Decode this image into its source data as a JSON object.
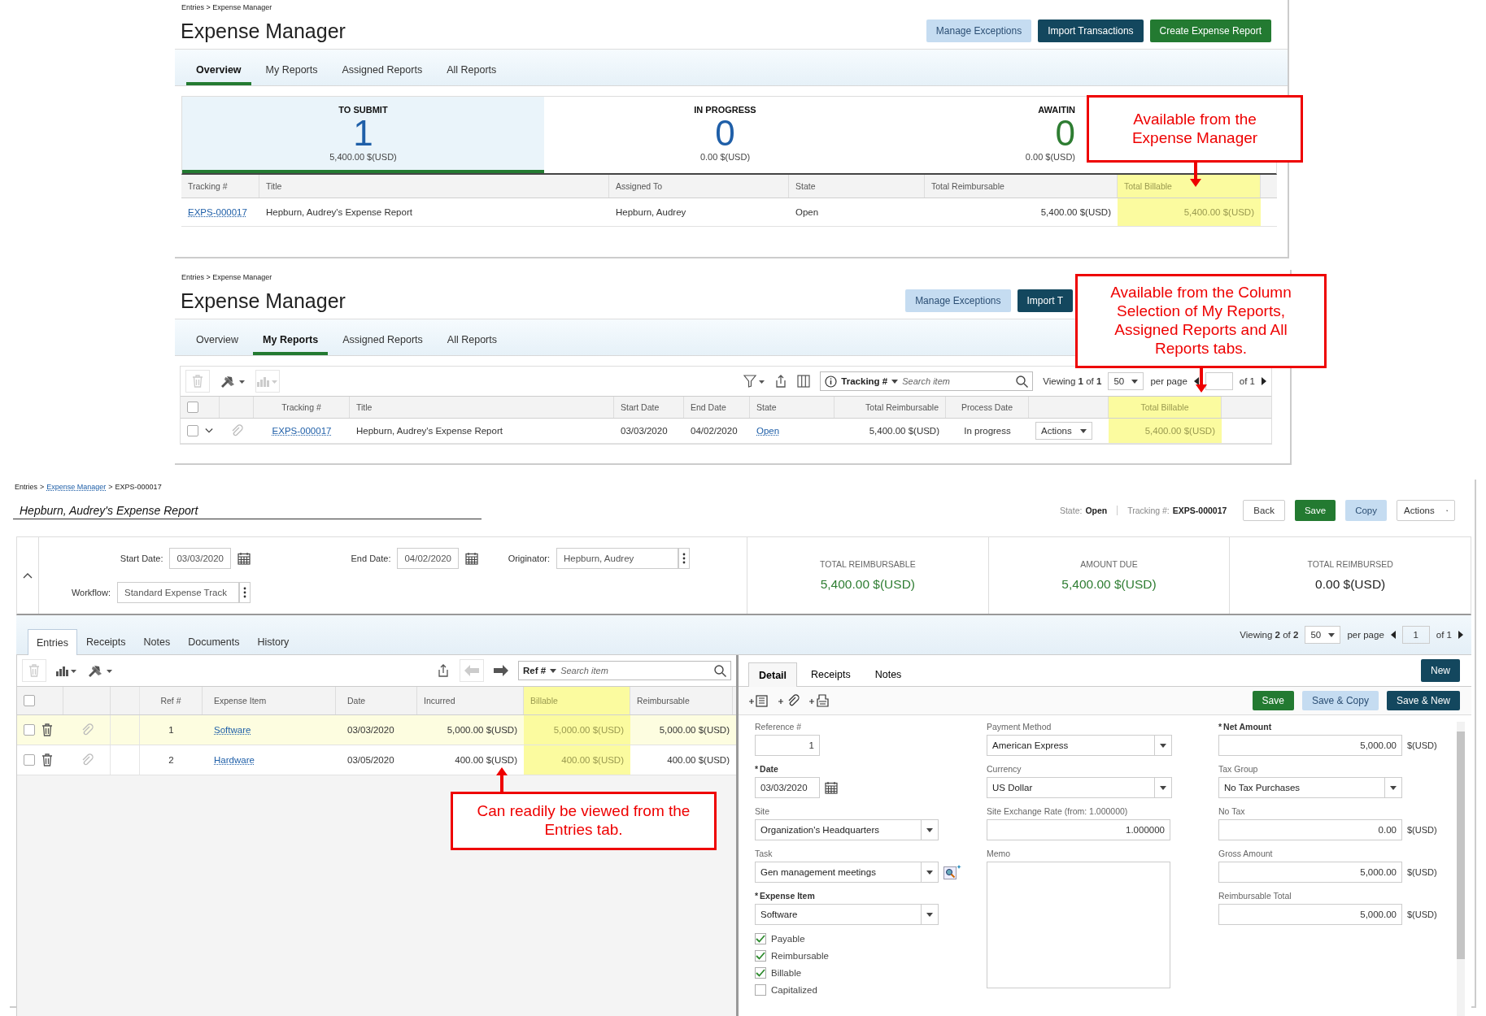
{
  "overview_panel": {
    "breadcrumb": "Entries > Expense Manager",
    "title": "Expense Manager",
    "buttons": [
      {
        "label": "Manage Exceptions",
        "kind": "light"
      },
      {
        "label": "Import Transactions",
        "kind": "dark"
      },
      {
        "label": "Create Expense Report",
        "kind": "green"
      }
    ],
    "tabs": [
      {
        "label": "Overview",
        "selected": true
      },
      {
        "label": "My Reports",
        "selected": false
      },
      {
        "label": "Assigned Reports",
        "selected": false
      },
      {
        "label": "All Reports",
        "selected": false
      }
    ],
    "stats": [
      {
        "label": "TO SUBMIT",
        "value": "1",
        "amount": "5,400.00 $(USD)",
        "selected": true,
        "color": "#1f5fa8"
      },
      {
        "label": "IN PROGRESS",
        "value": "0",
        "amount": "0.00 $(USD)",
        "selected": false,
        "color": "#1f5fa8"
      },
      {
        "label": "AWAITIN",
        "value": "0",
        "amount": "0.00 $(USD)",
        "selected": false,
        "color": "#2e7d32"
      }
    ],
    "table": {
      "columns": [
        {
          "label": "Tracking #",
          "highlighted": false,
          "kind": "link"
        },
        {
          "label": "Title",
          "highlighted": false,
          "kind": "text"
        },
        {
          "label": "Assigned To",
          "highlighted": false,
          "kind": "text"
        },
        {
          "label": "State",
          "highlighted": false,
          "kind": "text"
        },
        {
          "label": "Total Reimbursable",
          "highlighted": false,
          "kind": "number"
        },
        {
          "label": "Total Billable",
          "highlighted": true,
          "kind": "number"
        }
      ],
      "rows": [
        [
          "EXPS-000017",
          "Hepburn, Audrey's Expense Report",
          "Hepburn, Audrey",
          "Open",
          "5,400.00 $(USD)",
          "5,400.00 $(USD)"
        ]
      ]
    },
    "callout": "Available from the Expense Manager"
  },
  "my_reports_panel": {
    "breadcrumb": "Entries > Expense Manager",
    "title": "Expense Manager",
    "buttons": [
      {
        "label": "Manage Exceptions",
        "kind": "light"
      },
      {
        "label": "Import T",
        "kind": "dark"
      }
    ],
    "tabs": [
      {
        "label": "Overview",
        "selected": false
      },
      {
        "label": "My Reports",
        "selected": true
      },
      {
        "label": "Assigned Reports",
        "selected": false
      },
      {
        "label": "All Reports",
        "selected": false
      }
    ],
    "search": {
      "field": "Tracking #",
      "placeholder": "Search item"
    },
    "pager": {
      "viewing": "Viewing **1** of **1**",
      "per_page_value": "50",
      "per_page": "per page",
      "of": "of 1"
    },
    "table": {
      "all_checked": false,
      "columns": [
        {
          "label": "Tracking #",
          "highlighted": false,
          "kind": "link"
        },
        {
          "label": "Title",
          "highlighted": false,
          "kind": "text"
        },
        {
          "label": "Start Date",
          "highlighted": false,
          "kind": "text"
        },
        {
          "label": "End Date",
          "highlighted": false,
          "kind": "text"
        },
        {
          "label": "State",
          "highlighted": false,
          "kind": "link"
        },
        {
          "label": "Total Reimbursable",
          "highlighted": false,
          "kind": "number"
        },
        {
          "label": "Process Date",
          "highlighted": false,
          "kind": "text"
        },
        {
          "highlighted": false,
          "kind": "menu"
        },
        {
          "label": "Total Billable",
          "highlighted": true,
          "kind": "number"
        }
      ],
      "rows": [
        {
          "checked": false,
          "cells": [
            "EXPS-000017",
            "Hepburn, Audrey's Expense Report",
            "03/03/2020",
            "04/02/2020",
            "Open",
            "5,400.00 $(USD)",
            "In progress",
            "Actions",
            "5,400.00 $(USD)"
          ]
        }
      ]
    },
    "callout": "Available from the Column Selection of My Reports, Assigned Reports and All Reports tabs."
  },
  "report_panel": {
    "breadcrumb": [
      {
        "text": "Entries",
        "link": false
      },
      {
        "text": "Expense Manager",
        "link": true
      },
      {
        "text": "EXPS-000017",
        "link": false
      }
    ],
    "breadcrumb_separator": ">",
    "title": "Hepburn, Audrey's Expense Report",
    "state_label": "State:",
    "state": "Open",
    "tracking_label": "Tracking #:",
    "tracking": "EXPS-000017",
    "buttons": [
      {
        "label": "Back",
        "kind": "plain"
      },
      {
        "label": "Save",
        "kind": "green"
      },
      {
        "label": "Copy",
        "kind": "light"
      },
      {
        "label": "Actions",
        "kind": "dropdown"
      }
    ],
    "header_fields": [
      {
        "label": "Start Date:",
        "value": "03/03/2020",
        "kind": "date"
      },
      {
        "label": "End Date:",
        "value": "04/02/2020",
        "kind": "date"
      },
      {
        "label": "Originator:",
        "value": "Hepburn, Audrey",
        "kind": "menu"
      },
      {
        "label": "Workflow:",
        "value": "Standard Expense Track",
        "kind": "menu"
      }
    ],
    "totals": [
      {
        "label": "TOTAL REIMBURSABLE",
        "value": "5,400.00 $(USD)",
        "color": "#2e7d32"
      },
      {
        "label": "AMOUNT DUE",
        "value": "5,400.00 $(USD)",
        "color": "#2e7d32"
      },
      {
        "label": "TOTAL REIMBURSED",
        "value": "0.00 $(USD)",
        "color": "#222222"
      }
    ],
    "tabs": [
      {
        "label": "Entries",
        "selected": true
      },
      {
        "label": "Receipts",
        "selected": false
      },
      {
        "label": "Notes",
        "selected": false
      },
      {
        "label": "Documents",
        "selected": false
      },
      {
        "label": "History",
        "selected": false
      }
    ],
    "pager": {
      "viewing": "Viewing **2** of **2**",
      "per_page_value": "50",
      "per_page": "per page",
      "page": "1",
      "of": "of 1"
    },
    "search": {
      "field": "Ref #",
      "placeholder": "Search item"
    },
    "entries": {
      "all_checked": false,
      "columns": [
        {
          "label": "Ref #",
          "highlighted": false
        },
        {
          "label": "Expense Item",
          "highlighted": false
        },
        {
          "label": "Date",
          "highlighted": false
        },
        {
          "label": "Incurred",
          "highlighted": false
        },
        {
          "label": "Billable",
          "highlighted": true
        },
        {
          "label": "Reimbursable",
          "highlighted": false
        }
      ],
      "rows": [
        {
          "ref": "1",
          "item": "Software",
          "date": "03/03/2020",
          "incurred": "5,000.00 $(USD)",
          "billable": "5,000.00 $(USD)",
          "reimbursable": "5,000.00 $(USD)",
          "selected": true,
          "checked": false
        },
        {
          "ref": "2",
          "item": "Hardware",
          "date": "03/05/2020",
          "incurred": "400.00 $(USD)",
          "billable": "400.00 $(USD)",
          "reimbursable": "400.00 $(USD)",
          "selected": false,
          "checked": false
        }
      ]
    },
    "callout": "Can readily be viewed from the Entries tab.",
    "detail": {
      "tabs": [
        {
          "label": "Detail",
          "selected": true
        },
        {
          "label": "Receipts",
          "selected": false
        },
        {
          "label": "Notes",
          "selected": false
        }
      ],
      "new_button": "New",
      "buttons": [
        {
          "label": "Save",
          "kind": "green"
        },
        {
          "label": "Save & Copy",
          "kind": "light"
        },
        {
          "label": "Save & New",
          "kind": "dark"
        }
      ],
      "required_mark": "*",
      "columns": [
        [
          {
            "label": "Reference #",
            "required": false,
            "kind": "short",
            "value": "1"
          },
          {
            "label": "Date",
            "required": true,
            "kind": "date",
            "value": "03/03/2020"
          },
          {
            "label": "Site",
            "required": false,
            "kind": "select",
            "value": "Organization's Headquarters"
          },
          {
            "label": "Task",
            "required": false,
            "kind": "lookup",
            "value": "Gen management meetings"
          },
          {
            "label": "Expense Item",
            "required": true,
            "kind": "select",
            "value": "Software"
          }
        ],
        [
          {
            "label": "Payment Method",
            "required": false,
            "kind": "select",
            "value": "American Express"
          },
          {
            "label": "Currency",
            "required": false,
            "kind": "select",
            "value": "US Dollar"
          },
          {
            "label": "Site Exchange Rate  (from: 1.000000)",
            "required": false,
            "kind": "number",
            "value": "1.000000"
          },
          {
            "label": "Memo",
            "required": false,
            "kind": "textarea"
          }
        ],
        [
          {
            "label": "Net Amount",
            "required": true,
            "kind": "amount",
            "value": "5,000.00",
            "unit": "$(USD)"
          },
          {
            "label": "Tax Group",
            "required": false,
            "kind": "select",
            "value": "No Tax Purchases"
          },
          {
            "label": "No Tax",
            "required": false,
            "kind": "amount",
            "value": "0.00",
            "unit": "$(USD)"
          },
          {
            "label": "Gross Amount",
            "required": false,
            "kind": "amount",
            "value": "5,000.00",
            "unit": "$(USD)"
          },
          {
            "label": "Reimbursable Total",
            "required": false,
            "kind": "amount",
            "value": "5,000.00",
            "unit": "$(USD)"
          }
        ]
      ],
      "checkboxes": [
        {
          "label": "Payable",
          "checked": true
        },
        {
          "label": "Reimbursable",
          "checked": true
        },
        {
          "label": "Billable",
          "checked": true
        },
        {
          "label": "Capitalized",
          "checked": false
        }
      ]
    }
  }
}
